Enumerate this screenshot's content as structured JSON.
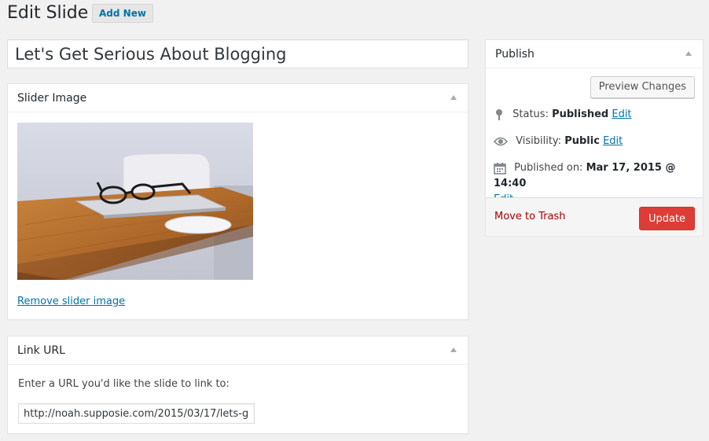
{
  "header": {
    "title": "Edit Slide",
    "add_new_label": "Add New"
  },
  "post": {
    "title": "Let's Get Serious About Blogging"
  },
  "slider_image": {
    "box_title": "Slider Image",
    "remove_label": "Remove slider image"
  },
  "link_url": {
    "box_title": "Link URL",
    "label": "Enter a URL you'd like the slide to link to:",
    "value": "http://noah.supposie.com/2015/03/17/lets-g"
  },
  "publish": {
    "box_title": "Publish",
    "preview_label": "Preview Changes",
    "status_label": "Status:",
    "status_value": "Published",
    "visibility_label": "Visibility:",
    "visibility_value": "Public",
    "published_on_label": "Published on:",
    "published_on_value": "Mar 17, 2015 @ 14:40",
    "edit_label": "Edit",
    "trash_label": "Move to Trash",
    "update_label": "Update"
  },
  "colors": {
    "accent": "#0073aa",
    "update": "#dd3d36",
    "trash": "#aa0000"
  },
  "icons": {
    "status": "pin-icon",
    "visibility": "eye-icon",
    "published_on": "calendar-icon",
    "toggle": "triangle-up-icon"
  }
}
